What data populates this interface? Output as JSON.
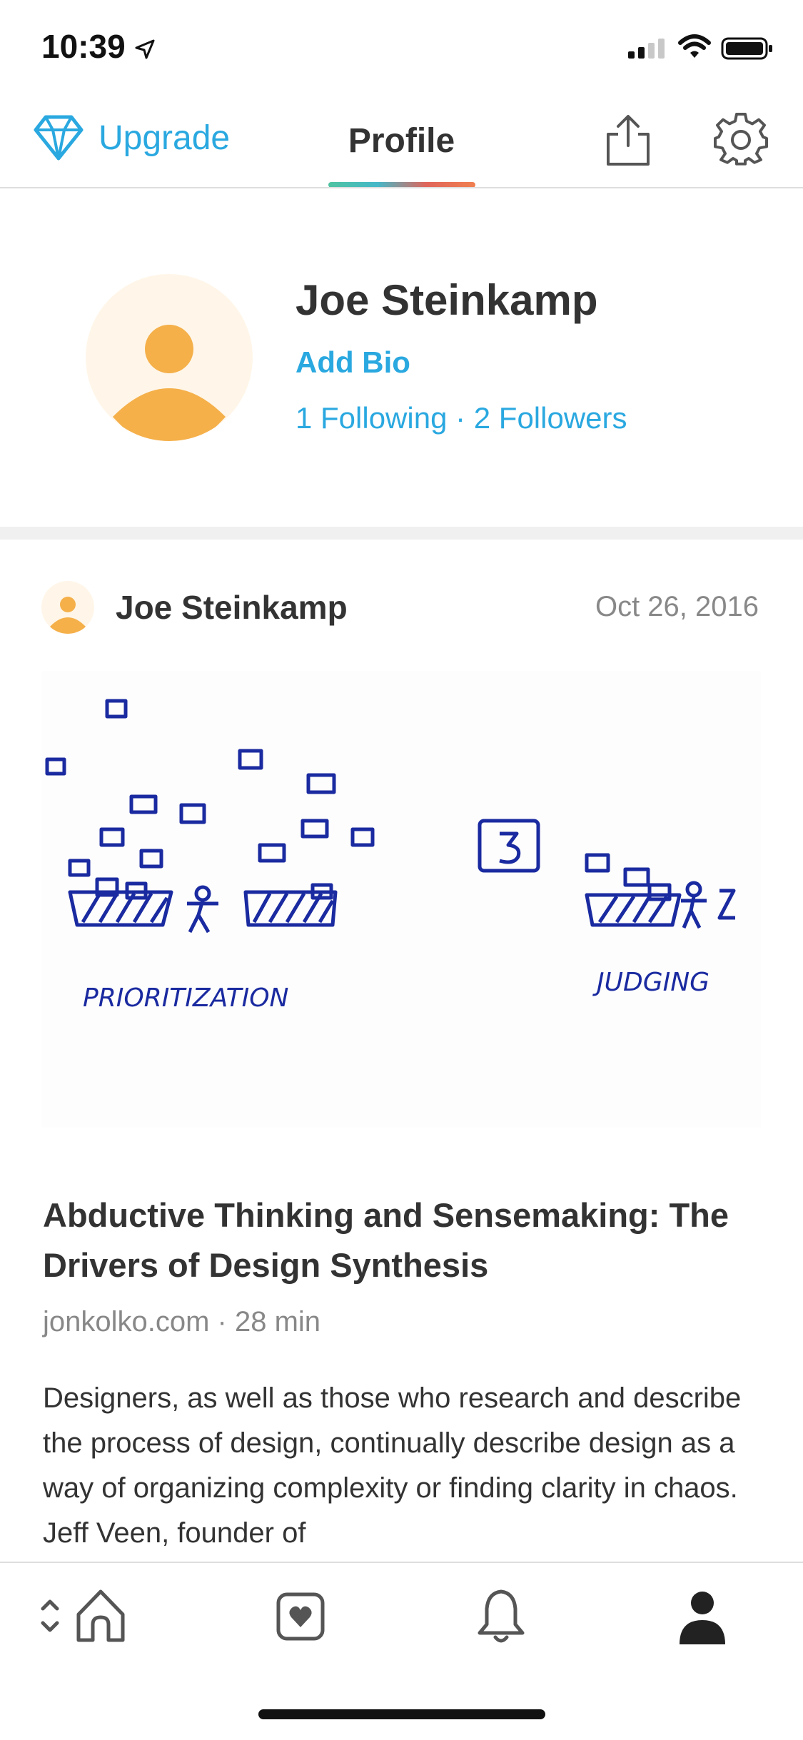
{
  "status_bar": {
    "time": "10:39"
  },
  "nav": {
    "upgrade_label": "Upgrade",
    "title": "Profile"
  },
  "profile": {
    "name": "Joe Steinkamp",
    "add_bio": "Add Bio",
    "follow_line": "1 Following · 2 Followers"
  },
  "post": {
    "author": "Joe Steinkamp",
    "date": "Oct 26, 2016",
    "image_labels": [
      "PRIORITIZATION",
      "JUDGING"
    ],
    "title": "Abductive Thinking and Sensemaking: The Drivers of Design Synthesis",
    "meta": "jonkolko.com · 28 min",
    "excerpt": "Designers, as well as those who research and describe the process of design, continually describe design as a way of organizing complexity or finding clarity in chaos. Jeff Veen, founder of"
  },
  "tab_bar": {
    "items": [
      "home-icon",
      "bookmark-heart-icon",
      "bell-icon",
      "person-icon"
    ],
    "active": "person-icon"
  },
  "colors": {
    "accent": "#2aa8e0",
    "avatar": "#f5b04a",
    "avatar_bg": "#fff6e9",
    "sketch_ink": "#1a2aa0"
  }
}
